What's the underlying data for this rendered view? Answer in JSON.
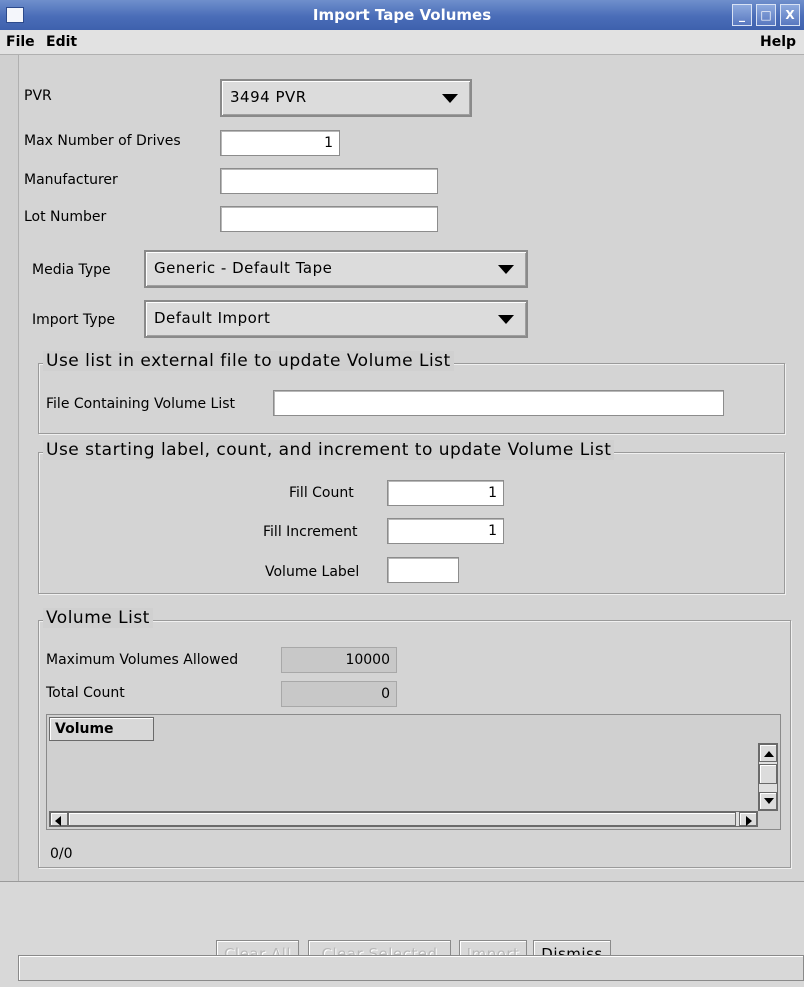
{
  "window": {
    "title": "Import Tape Volumes",
    "controls": [
      "_",
      "□",
      "X"
    ]
  },
  "menu": {
    "file": "File",
    "edit": "Edit",
    "help": "Help"
  },
  "form": {
    "pvr_label": "PVR",
    "pvr_value": "3494 PVR",
    "max_drives_label": "Max Number of Drives",
    "max_drives_value": "1",
    "manufacturer_label": "Manufacturer",
    "manufacturer_value": "",
    "lot_label": "Lot Number",
    "lot_value": "",
    "media_type_label": "Media Type",
    "media_type_value": "Generic - Default Tape",
    "import_type_label": "Import Type",
    "import_type_value": "Default Import"
  },
  "external_file": {
    "title": "Use list in external file to update Volume List",
    "file_label": "File Containing Volume List",
    "file_value": ""
  },
  "fill": {
    "title": "Use starting label, count, and increment to update Volume List",
    "count_label": "Fill Count",
    "count_value": "1",
    "increment_label": "Fill Increment",
    "increment_value": "1",
    "volume_label_label": "Volume Label",
    "volume_label_value": ""
  },
  "volume_list": {
    "title": "Volume List",
    "max_label": "Maximum Volumes Allowed",
    "max_value": "10000",
    "total_label": "Total Count",
    "total_value": "0",
    "column_header": "Volume",
    "position": "0/0"
  },
  "buttons": {
    "clear_all": "Clear All",
    "clear_selected": "Clear Selected",
    "import": "Import",
    "dismiss": "Dismiss"
  },
  "colors": {
    "titlebar": "#4a6db8",
    "background": "#d0d0d0"
  }
}
